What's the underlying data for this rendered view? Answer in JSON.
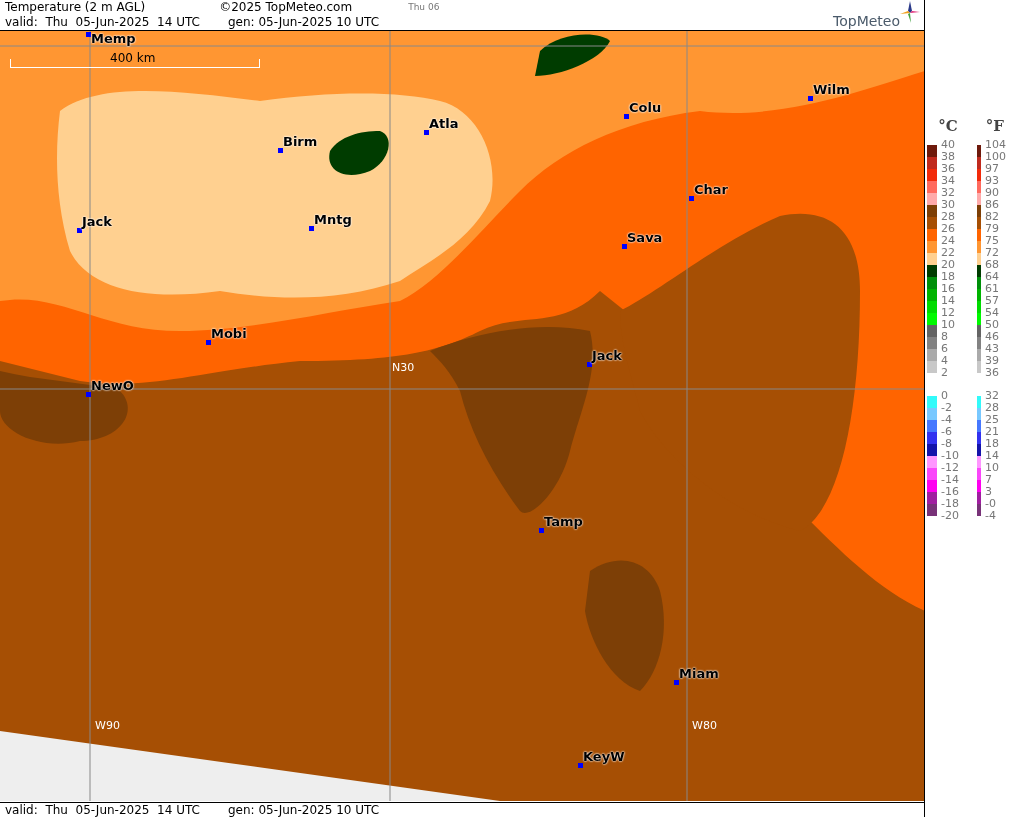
{
  "header": {
    "title": "Temperature (2 m AGL)",
    "copyright": "©2025 TopMeteo.com",
    "day": "Thu 06",
    "valid": "valid:  Thu  05-Jun-2025  14 UTC",
    "generated": "gen: 05-Jun-2025 10 UTC",
    "logo": "TopMeteo"
  },
  "map": {
    "scale": "400 km",
    "places": [
      {
        "kind": "city",
        "label": "Memp"
      },
      {
        "kind": "city",
        "label": "Birm"
      },
      {
        "kind": "city",
        "label": "Atla"
      },
      {
        "kind": "city",
        "label": "Colu"
      },
      {
        "kind": "city",
        "label": "Wilm"
      },
      {
        "kind": "city",
        "label": "Jack"
      },
      {
        "kind": "city",
        "label": "Mntg"
      },
      {
        "kind": "city",
        "label": "Char"
      },
      {
        "kind": "city",
        "label": "Sava"
      },
      {
        "kind": "city",
        "label": "Mobi"
      },
      {
        "kind": "city",
        "label": "Jack"
      },
      {
        "kind": "city",
        "label": "NewO"
      },
      {
        "kind": "grid",
        "label": "N30"
      },
      {
        "kind": "city",
        "label": "Tamp"
      },
      {
        "kind": "city",
        "label": "Miam"
      },
      {
        "kind": "city",
        "label": "KeyW"
      },
      {
        "kind": "grid",
        "label": "W90"
      },
      {
        "kind": "grid",
        "label": "W80"
      }
    ]
  },
  "legend": {
    "celsius_unit": "°C",
    "fahrenheit_unit": "°F",
    "groups": [
      [
        {
          "c": "40",
          "f": "104",
          "color": "#6e1a0c"
        },
        {
          "c": "38",
          "f": "100",
          "color": "#c02a1e"
        },
        {
          "c": "36",
          "f": "97",
          "color": "#f22a0a"
        },
        {
          "c": "34",
          "f": "93",
          "color": "#ff6a5e"
        },
        {
          "c": "32",
          "f": "90",
          "color": "#ffaaaa"
        },
        {
          "c": "30",
          "f": "86",
          "color": "#7d3f06"
        },
        {
          "c": "28",
          "f": "82",
          "color": "#a64f04"
        },
        {
          "c": "26",
          "f": "79",
          "color": "#ff6400"
        },
        {
          "c": "24",
          "f": "75",
          "color": "#ff9632"
        },
        {
          "c": "22",
          "f": "72",
          "color": "#ffd090"
        },
        {
          "c": "20",
          "f": "68",
          "color": "#003c00"
        },
        {
          "c": "18",
          "f": "64",
          "color": "#00900a"
        },
        {
          "c": "16",
          "f": "61",
          "color": "#00b400"
        },
        {
          "c": "14",
          "f": "57",
          "color": "#00dc00"
        },
        {
          "c": "12",
          "f": "54",
          "color": "#00fa00"
        },
        {
          "c": "10",
          "f": "50",
          "color": "#646464"
        },
        {
          "c": "8",
          "f": "46",
          "color": "#828282"
        },
        {
          "c": "6",
          "f": "43",
          "color": "#aaaaaa"
        },
        {
          "c": "4",
          "f": "39",
          "color": "#c8c8c8"
        },
        {
          "c": "2",
          "f": "36"
        }
      ],
      [
        {
          "c": "0",
          "f": "32",
          "color": "#32fafa"
        },
        {
          "c": "-2",
          "f": "28",
          "color": "#78c8ff"
        },
        {
          "c": "-4",
          "f": "25",
          "color": "#4678ff"
        },
        {
          "c": "-6",
          "f": "21",
          "color": "#3232f0"
        },
        {
          "c": "-8",
          "f": "18",
          "color": "#1414aa"
        },
        {
          "c": "-10",
          "f": "14",
          "color": "#ff96ff"
        },
        {
          "c": "-12",
          "f": "10",
          "color": "#fa46fa"
        },
        {
          "c": "-14",
          "f": "7",
          "color": "#ff00f0"
        },
        {
          "c": "-16",
          "f": "3",
          "color": "#a01ea0"
        },
        {
          "c": "-18",
          "f": "-0",
          "color": "#783278"
        },
        {
          "c": "-20",
          "f": "-4"
        }
      ]
    ]
  },
  "footer": {
    "valid": "valid:  Thu  05-Jun-2025  14 UTC",
    "generated": "gen: 05-Jun-2025 10 UTC"
  }
}
